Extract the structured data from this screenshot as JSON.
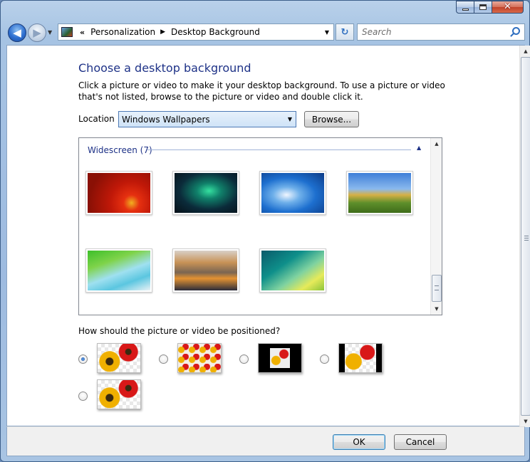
{
  "window": {
    "minimize_icon": "minimize-icon",
    "maximize_icon": "maximize-icon",
    "close_icon": "close-icon"
  },
  "navbar": {
    "back_glyph": "◀",
    "forward_glyph": "▶",
    "overflow": "«",
    "breadcrumbs": [
      "Personalization",
      "Desktop Background"
    ],
    "breadcrumb_separator": "▶",
    "dropdown_glyph": "▼",
    "refresh_glyph": "↻",
    "search_placeholder": "Search"
  },
  "main": {
    "heading": "Choose a desktop background",
    "description": "Click a picture or video to make it your desktop background. To use a picture or video that's not listed, browse to the picture or video and double click it.",
    "location_label": "Location",
    "location_value": "Windows Wallpapers",
    "browse_label": "Browse...",
    "gallery": {
      "group_label": "Widescreen (7)",
      "collapse_glyph": "▲",
      "wallpapers": [
        "red-gerbera-flower",
        "aurora-over-lake",
        "fish-school-underwater",
        "green-hills-landscape",
        "palm-frond-beach",
        "rock-mountain-reflection",
        "vista-aurora-abstract"
      ]
    },
    "position_label": "How should the picture or video be positioned?",
    "position_options": [
      {
        "id": "fill",
        "selected": true
      },
      {
        "id": "tile",
        "selected": false
      },
      {
        "id": "center",
        "selected": false
      },
      {
        "id": "fit",
        "selected": false
      },
      {
        "id": "stretch",
        "selected": false
      }
    ]
  },
  "footer": {
    "ok_label": "OK",
    "cancel_label": "Cancel"
  },
  "colors": {
    "heading": "#1e3287",
    "frame": "#a6c3e3",
    "selection": "#cfe3f7"
  }
}
